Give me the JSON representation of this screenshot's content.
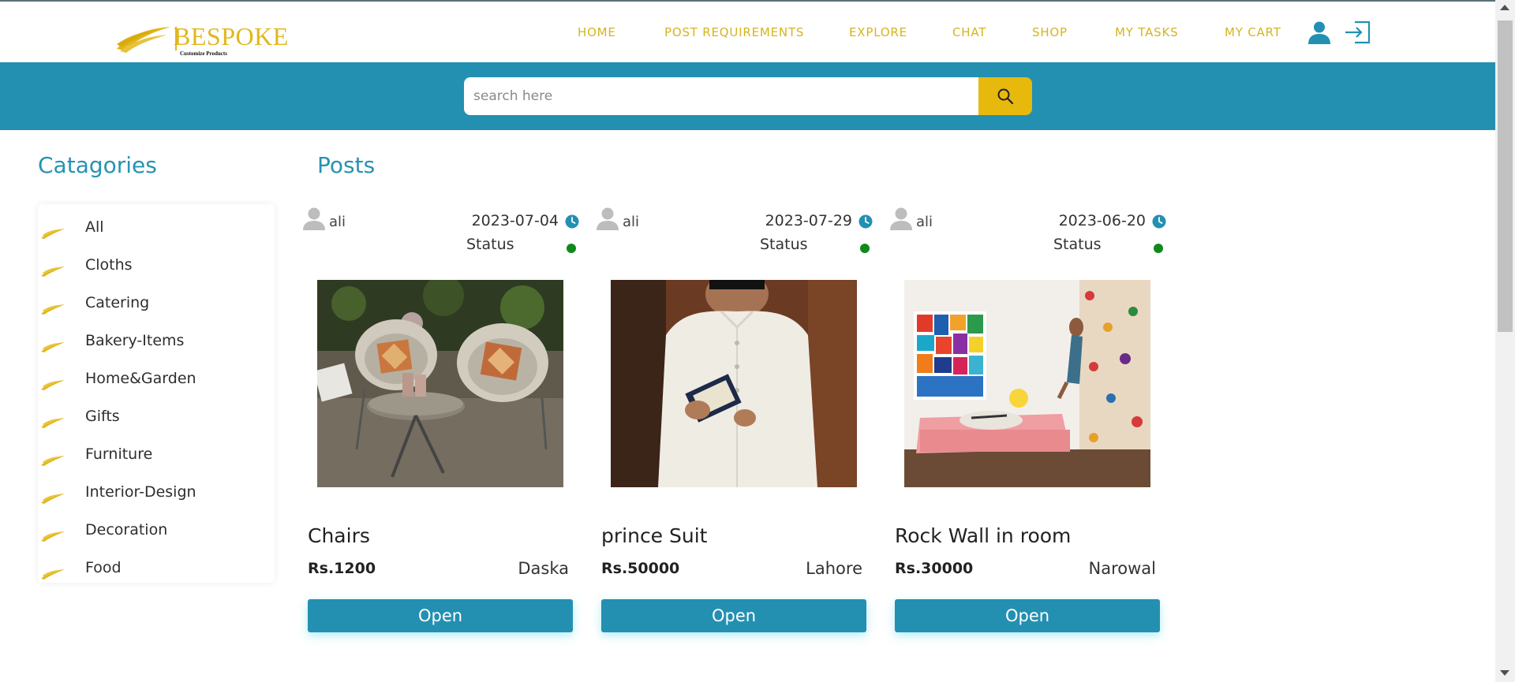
{
  "brand": {
    "name": "BESPOKE",
    "tagline": "Customize Products",
    "color": "#e2b71a"
  },
  "nav": {
    "items": [
      {
        "label": "HOME"
      },
      {
        "label": "POST REQUIREMENTS"
      },
      {
        "label": "EXPLORE"
      },
      {
        "label": "CHAT"
      },
      {
        "label": "SHOP"
      },
      {
        "label": "MY TASKS"
      },
      {
        "label": "MY CART"
      }
    ],
    "profile_icon": "user-icon",
    "logout_icon": "logout-icon"
  },
  "search": {
    "placeholder": "search here",
    "value": "",
    "button_icon": "search-icon"
  },
  "categories": {
    "heading": "Catagories",
    "icon": "wing-icon",
    "items": [
      {
        "label": "All"
      },
      {
        "label": "Cloths"
      },
      {
        "label": "Catering"
      },
      {
        "label": "Bakery-Items"
      },
      {
        "label": "Home&Garden"
      },
      {
        "label": "Gifts"
      },
      {
        "label": "Furniture"
      },
      {
        "label": "Interior-Design"
      },
      {
        "label": "Decoration"
      },
      {
        "label": "Food"
      }
    ]
  },
  "posts": {
    "heading": "Posts",
    "items": [
      {
        "user": "ali",
        "date": "2023-07-04",
        "status_label": "Status",
        "title": "Chairs",
        "price": "Rs.1200",
        "city": "Daska",
        "button": "Open",
        "image": "outdoor wicker chairs photo"
      },
      {
        "user": "ali",
        "date": "2023-07-29",
        "status_label": "Status",
        "title": "prince Suit",
        "price": "Rs.50000",
        "city": "Lahore",
        "button": "Open",
        "image": "white prince suit photo"
      },
      {
        "user": "ali",
        "date": "2023-06-20",
        "status_label": "Status",
        "title": "Rock Wall in room",
        "price": "Rs.30000",
        "city": "Narowal",
        "button": "Open",
        "image": "climbing rock wall room photo"
      }
    ]
  },
  "colors": {
    "accent": "#2390b1",
    "nav_text": "#d5b41e",
    "search_button": "#e7b90d",
    "status_active": "#0f8a1a"
  }
}
